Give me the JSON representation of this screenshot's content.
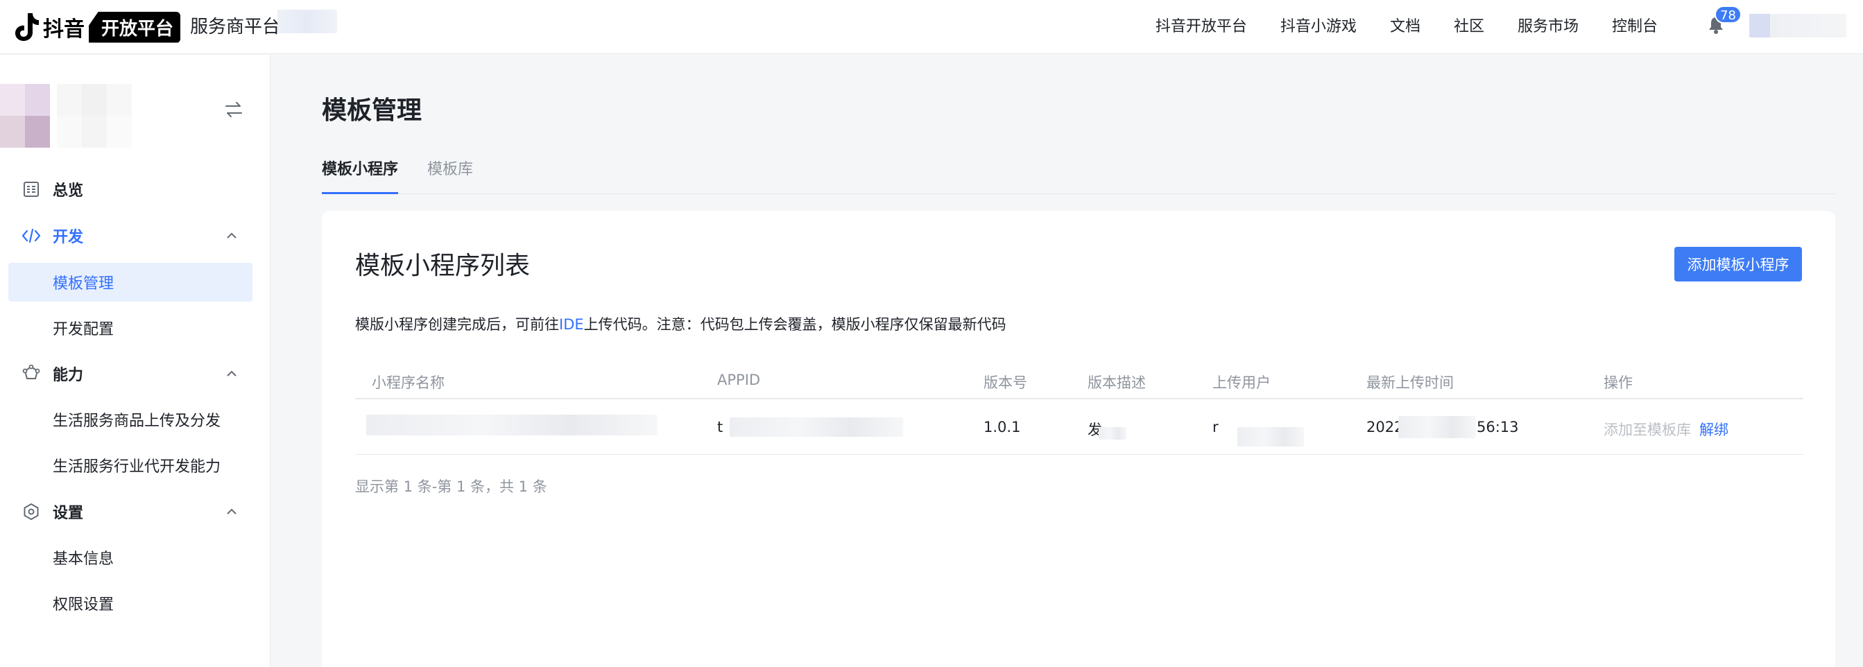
{
  "header": {
    "brand": "抖音",
    "brand_tag": "开放平台",
    "platform_name": "服务商平台",
    "nav": [
      "抖音开放平台",
      "抖音小游戏",
      "文档",
      "社区",
      "服务市场",
      "控制台"
    ],
    "notification_count": "78"
  },
  "sidebar": {
    "groups": [
      {
        "label": "总览",
        "icon": "dashboard-icon"
      },
      {
        "label": "开发",
        "icon": "code-icon",
        "items": [
          "模板管理",
          "开发配置"
        ]
      },
      {
        "label": "能力",
        "icon": "capability-icon",
        "items": [
          "生活服务商品上传及分发",
          "生活服务行业代开发能力"
        ]
      },
      {
        "label": "设置",
        "icon": "settings-icon",
        "items": [
          "基本信息",
          "权限设置"
        ]
      }
    ],
    "active_item": "模板管理"
  },
  "page": {
    "title": "模板管理",
    "tabs": [
      "模板小程序",
      "模板库"
    ],
    "active_tab": "模板小程序"
  },
  "card": {
    "title": "模板小程序列表",
    "add_button": "添加模板小程序",
    "notice_before": "模版小程序创建完成后，可前往",
    "notice_link": "IDE",
    "notice_after": "上传代码。注意：代码包上传会覆盖，模版小程序仅保留最新代码"
  },
  "table": {
    "columns": [
      "小程序名称",
      "APPID",
      "版本号",
      "版本描述",
      "上传用户",
      "最新上传时间",
      "操作"
    ],
    "rows": [
      {
        "name": "",
        "appid": "t",
        "version": "1.0.1",
        "description": "发",
        "uploader": "r",
        "upload_time_start": "2022",
        "upload_time_end": "56:13",
        "action_disabled": "添加至模板库",
        "action_link": "解绑"
      }
    ],
    "pagination": "显示第 1 条-第 1 条，共 1 条"
  },
  "colors": {
    "accent": "#3370ff",
    "button": "#3d7cf5"
  }
}
